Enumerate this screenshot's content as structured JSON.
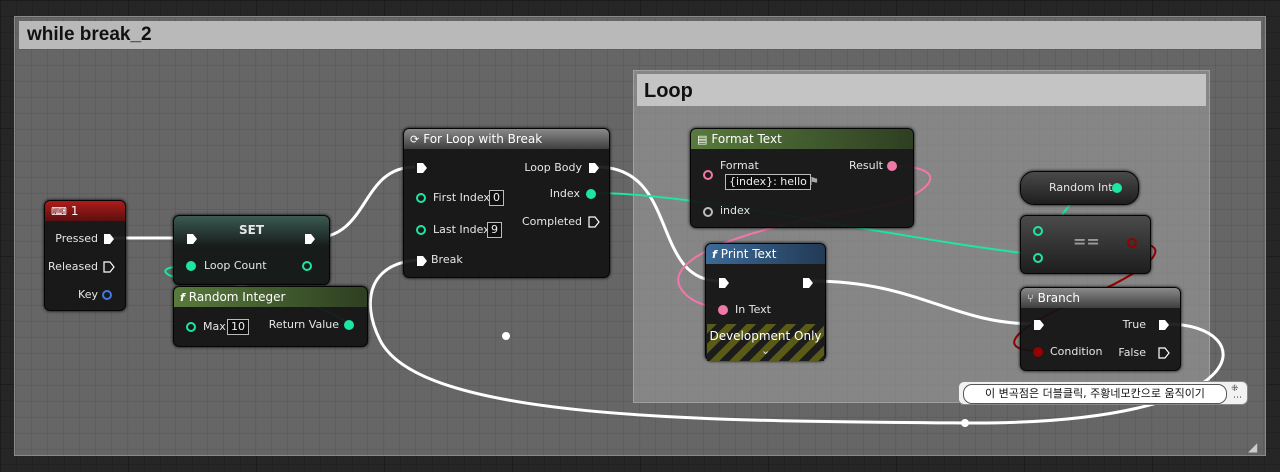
{
  "comments": {
    "outer_title": "while break_2",
    "inner_title": "Loop"
  },
  "nodes": {
    "key1": {
      "title": "1",
      "pressed": "Pressed",
      "released": "Released",
      "key": "Key"
    },
    "set": {
      "title": "SET",
      "loop_count": "Loop Count"
    },
    "random_integer": {
      "title": "Random Integer",
      "max_label": "Max",
      "max_value": "10",
      "return_value": "Return Value"
    },
    "for_loop": {
      "title": "For Loop with Break",
      "first_index": "First Index",
      "first_index_value": "0",
      "last_index": "Last Index",
      "last_index_value": "9",
      "break": "Break",
      "loop_body": "Loop Body",
      "index": "Index",
      "completed": "Completed"
    },
    "format_text": {
      "title": "Format Text",
      "format_label": "Format",
      "format_value": "{index}: hello",
      "result": "Result",
      "index_label": "index"
    },
    "print_text": {
      "title": "Print Text",
      "in_text": "In Text",
      "dev_only": "Development Only"
    },
    "random_int_var": {
      "title": "Random Int"
    },
    "equals": {
      "title": "=="
    },
    "branch": {
      "title": "Branch",
      "condition": "Condition",
      "true_label": "True",
      "false_label": "False"
    }
  },
  "tooltip": {
    "text": "이 변곡점은 더블클릭, 주황네모칸으로 움직이기"
  },
  "colors": {
    "exec": "#ffffff",
    "integer": "#1de5a5",
    "string": "#f078a8",
    "boolean": "#950000",
    "wildcard": "#bdbdbd"
  }
}
